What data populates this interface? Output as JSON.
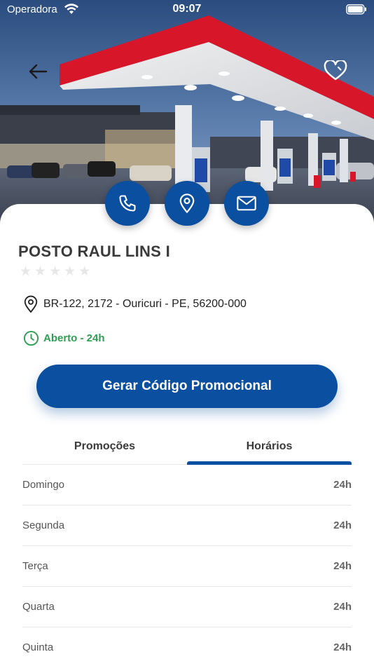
{
  "status_bar": {
    "carrier": "Operadora",
    "time": "09:07"
  },
  "header": {
    "back_icon": "arrow-left-icon",
    "favorite_icon": "heart-outline-icon"
  },
  "actions": {
    "phone_icon": "phone-icon",
    "map_icon": "map-pin-icon",
    "mail_icon": "mail-icon"
  },
  "station": {
    "name": "POSTO RAUL LINS I",
    "rating": 0,
    "rating_max": 5,
    "address": "BR-122, 2172 - Ouricuri - PE, 56200-000",
    "open_status": "Aberto - 24h"
  },
  "promo_button": {
    "label": "Gerar Código Promocional"
  },
  "tabs": [
    {
      "label": "Promoções",
      "active": false
    },
    {
      "label": "Horários",
      "active": true
    }
  ],
  "schedule": [
    {
      "day": "Domingo",
      "hours": "24h"
    },
    {
      "day": "Segunda",
      "hours": "24h"
    },
    {
      "day": "Terça",
      "hours": "24h"
    },
    {
      "day": "Quarta",
      "hours": "24h"
    },
    {
      "day": "Quinta",
      "hours": "24h"
    }
  ],
  "colors": {
    "primary": "#0a4fa0",
    "open_green": "#2e9e52",
    "title_text": "#3a3a3a",
    "star_empty": "#e7e7e7",
    "canopy_red": "#d7162a"
  }
}
